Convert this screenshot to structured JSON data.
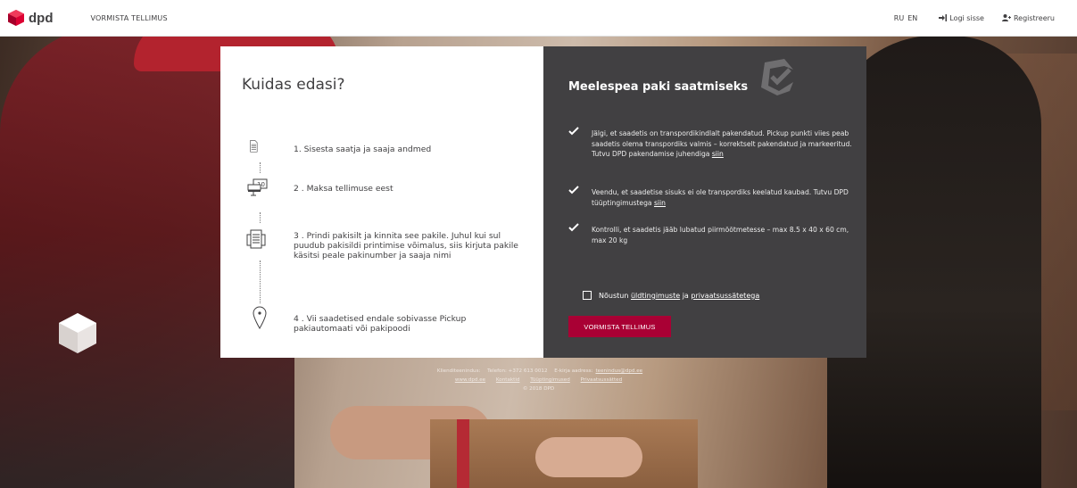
{
  "header": {
    "brand": "dpd",
    "page_title": "VORMISTA TELLIMUS",
    "languages": [
      "RU",
      "EN"
    ],
    "login_label": "Logi sisse",
    "register_label": "Registreeru"
  },
  "how_to": {
    "title": "Kuidas edasi?",
    "steps": [
      {
        "text": "1. Sisesta saatja ja saaja andmed",
        "icon": "document-icon"
      },
      {
        "text": "2 . Maksa tellimuse eest",
        "icon": "payment-icon"
      },
      {
        "text": "3 . Prindi pakisilt ja kinnita see pakile. Juhul kui sul puudub pakisildi printimise võimalus, siis kirjuta pakile käsitsi peale pakinumber ja saaja nimi",
        "icon": "printer-icon"
      },
      {
        "text": "4 . Vii saadetised endale sobivasse Pickup pakiautomaati või pakipoodi",
        "icon": "location-pin-icon"
      }
    ]
  },
  "reminder": {
    "title": "Meelespea paki saatmiseks",
    "rules": [
      {
        "text": "Jälgi, et saadetis on transpordikindlalt pakendatud. Pickup punkti viies peab saadetis olema transpordiks valmis – korrektselt pakendatud ja markeeritud. Tutvu DPD pakendamise juhendiga",
        "link": "siin"
      },
      {
        "text": "Veendu, et saadetise sisuks ei ole transpordiks keelatud kaubad. Tutvu DPD tüüptingimustega",
        "link": "siin"
      },
      {
        "text": "Kontrolli, et saadetis jääb lubatud piirmõõtmetesse – max 8.5 x 40 x 60 cm, max 20 kg",
        "link": ""
      }
    ],
    "agree_prefix": "Nõustun",
    "agree_link1": "üldtingimuste",
    "agree_mid": "ja",
    "agree_link2": "privaatsussätetega",
    "agree_checked": false,
    "submit_label": "VORMISTA TELLIMUS"
  },
  "footer": {
    "service_label": "Klienditeenindus:",
    "phone": "Telefon: +372 613 0012",
    "email_label": "E-kirja aadress:",
    "email": "teenindus@dpd.ee",
    "links": [
      "www.dpd.ee",
      "Kontaktid",
      "Tüüptingimused",
      "Privaatsussätted"
    ],
    "copyright": "© 2018 DPD"
  },
  "colors": {
    "brand_red": "#dc0032",
    "button": "#a90034",
    "dark_panel": "#414042"
  }
}
